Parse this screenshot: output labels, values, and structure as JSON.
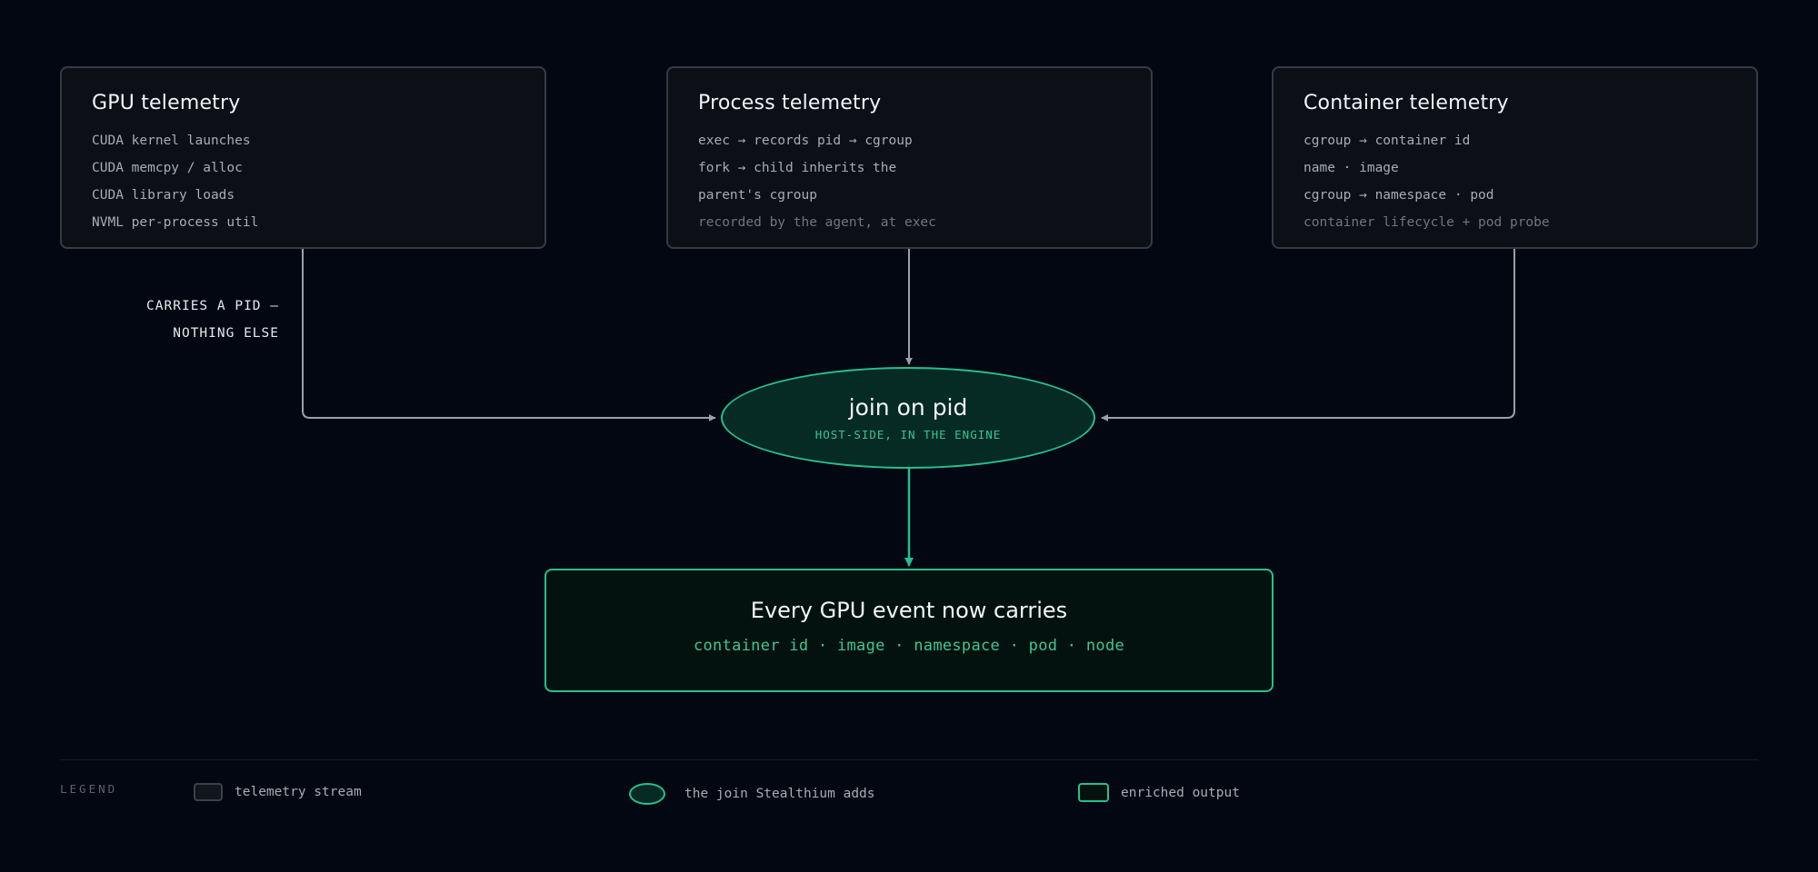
{
  "sources": [
    {
      "title": "GPU telemetry",
      "lines": [
        "CUDA kernel launches",
        "CUDA memcpy / alloc",
        "CUDA library loads",
        "NVML per-process util"
      ],
      "note": ""
    },
    {
      "title": "Process telemetry",
      "lines": [
        "exec → records pid → cgroup",
        "fork → child inherits the",
        "parent's cgroup"
      ],
      "note": "recorded by the agent, at exec"
    },
    {
      "title": "Container telemetry",
      "lines": [
        "cgroup → container id",
        "name · image",
        "cgroup → namespace · pod"
      ],
      "note": "container lifecycle + pod probe"
    }
  ],
  "gpu_edge_label": [
    "CARRIES A PID —",
    "NOTHING ELSE"
  ],
  "join": {
    "title": "join on pid",
    "subtitle": "HOST-SIDE, IN THE ENGINE"
  },
  "output": {
    "title": "Every GPU event now carries",
    "fields": "container id · image · namespace · pod · node"
  },
  "legend": {
    "title": "LEGEND",
    "items": [
      {
        "label": "telemetry stream",
        "icon": "rounded-rect-gray"
      },
      {
        "label": "the join Stealthium adds",
        "icon": "ellipse-green"
      },
      {
        "label": "enriched output",
        "icon": "rounded-rect-green"
      }
    ]
  },
  "colors": {
    "background": "#030711",
    "accent": "#25c08e",
    "wire": "#9ba0aa"
  }
}
